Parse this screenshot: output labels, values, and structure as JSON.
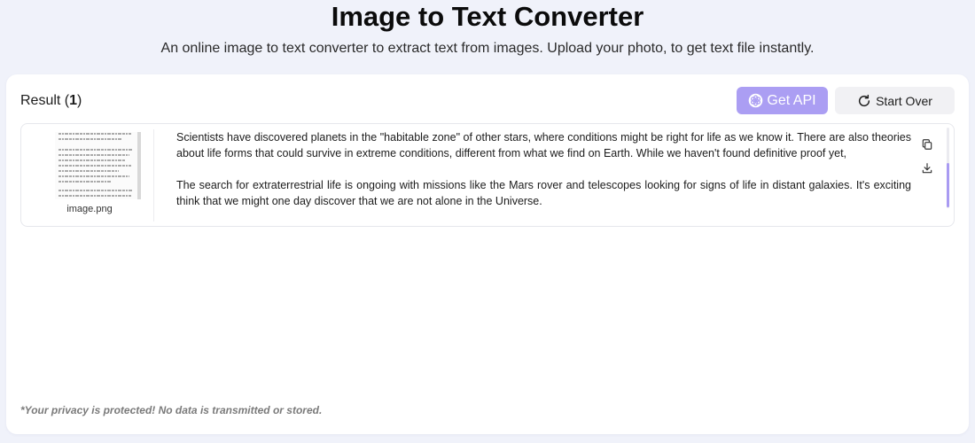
{
  "header": {
    "title": "Image to Text Converter",
    "subtitle": "An online image to text converter to extract text from images. Upload your photo, to get text file instantly."
  },
  "result": {
    "heading_prefix": "Result (",
    "count": "1",
    "heading_suffix": ")"
  },
  "toolbar": {
    "get_api_label": "Get API",
    "get_api_icon": "openai-knot-icon",
    "start_over_label": "Start Over",
    "start_over_icon": "refresh-icon"
  },
  "items": [
    {
      "filename": "image.png",
      "paragraphs": [
        "Scientists have discovered planets in the \"habitable zone\" of other stars, where conditions might be right for life as we know it. There are also theories about life forms that could survive in extreme conditions, different from what we find on Earth. While we haven't found definitive proof yet,",
        "The search for extraterrestrial life is ongoing with missions like the Mars rover and telescopes looking for signs of life in distant galaxies. It's exciting think that we might one day discover that we are not alone in the Universe."
      ],
      "actions": {
        "copy_icon": "copy-icon",
        "download_icon": "download-icon"
      }
    }
  ],
  "footer": {
    "privacy_note": "*Your privacy is protected! No data is transmitted or stored."
  },
  "colors": {
    "page_background": "#f0f2fa",
    "accent": "#ab9ef3",
    "scrollbar_thumb": "#a99bf2",
    "start_over_background": "#f1f1f4"
  }
}
